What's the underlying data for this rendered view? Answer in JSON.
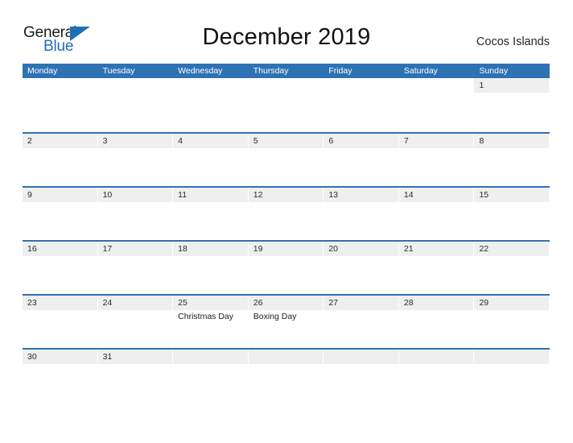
{
  "logo": {
    "word_one": "General",
    "word_two": "Blue",
    "triangle_icon": "triangle-icon",
    "primary_color": "#1f6fb4"
  },
  "header": {
    "title": "December 2019",
    "region": "Cocos Islands"
  },
  "theme": {
    "header_blue": "#2f72b4",
    "row_rule_blue": "#2f72b4",
    "date_band_gray": "#efefef",
    "text_dark": "#2a2a2a",
    "text_white": "#ffffff"
  },
  "calendar": {
    "month": "December",
    "year": "2019",
    "weekdays": [
      "Monday",
      "Tuesday",
      "Wednesday",
      "Thursday",
      "Friday",
      "Saturday",
      "Sunday"
    ],
    "weeks": [
      [
        {
          "date": "",
          "event": "",
          "filled": false
        },
        {
          "date": "",
          "event": "",
          "filled": false
        },
        {
          "date": "",
          "event": "",
          "filled": false
        },
        {
          "date": "",
          "event": "",
          "filled": false
        },
        {
          "date": "",
          "event": "",
          "filled": false
        },
        {
          "date": "",
          "event": "",
          "filled": false
        },
        {
          "date": "1",
          "event": "",
          "filled": true
        }
      ],
      [
        {
          "date": "2",
          "event": "",
          "filled": true
        },
        {
          "date": "3",
          "event": "",
          "filled": true
        },
        {
          "date": "4",
          "event": "",
          "filled": true
        },
        {
          "date": "5",
          "event": "",
          "filled": true
        },
        {
          "date": "6",
          "event": "",
          "filled": true
        },
        {
          "date": "7",
          "event": "",
          "filled": true
        },
        {
          "date": "8",
          "event": "",
          "filled": true
        }
      ],
      [
        {
          "date": "9",
          "event": "",
          "filled": true
        },
        {
          "date": "10",
          "event": "",
          "filled": true
        },
        {
          "date": "11",
          "event": "",
          "filled": true
        },
        {
          "date": "12",
          "event": "",
          "filled": true
        },
        {
          "date": "13",
          "event": "",
          "filled": true
        },
        {
          "date": "14",
          "event": "",
          "filled": true
        },
        {
          "date": "15",
          "event": "",
          "filled": true
        }
      ],
      [
        {
          "date": "16",
          "event": "",
          "filled": true
        },
        {
          "date": "17",
          "event": "",
          "filled": true
        },
        {
          "date": "18",
          "event": "",
          "filled": true
        },
        {
          "date": "19",
          "event": "",
          "filled": true
        },
        {
          "date": "20",
          "event": "",
          "filled": true
        },
        {
          "date": "21",
          "event": "",
          "filled": true
        },
        {
          "date": "22",
          "event": "",
          "filled": true
        }
      ],
      [
        {
          "date": "23",
          "event": "",
          "filled": true
        },
        {
          "date": "24",
          "event": "",
          "filled": true
        },
        {
          "date": "25",
          "event": "Christmas Day",
          "filled": true
        },
        {
          "date": "26",
          "event": "Boxing Day",
          "filled": true
        },
        {
          "date": "27",
          "event": "",
          "filled": true
        },
        {
          "date": "28",
          "event": "",
          "filled": true
        },
        {
          "date": "29",
          "event": "",
          "filled": true
        }
      ],
      [
        {
          "date": "30",
          "event": "",
          "filled": true
        },
        {
          "date": "31",
          "event": "",
          "filled": true
        },
        {
          "date": "",
          "event": "",
          "filled": true
        },
        {
          "date": "",
          "event": "",
          "filled": true
        },
        {
          "date": "",
          "event": "",
          "filled": true
        },
        {
          "date": "",
          "event": "",
          "filled": true
        },
        {
          "date": "",
          "event": "",
          "filled": true
        }
      ]
    ]
  }
}
